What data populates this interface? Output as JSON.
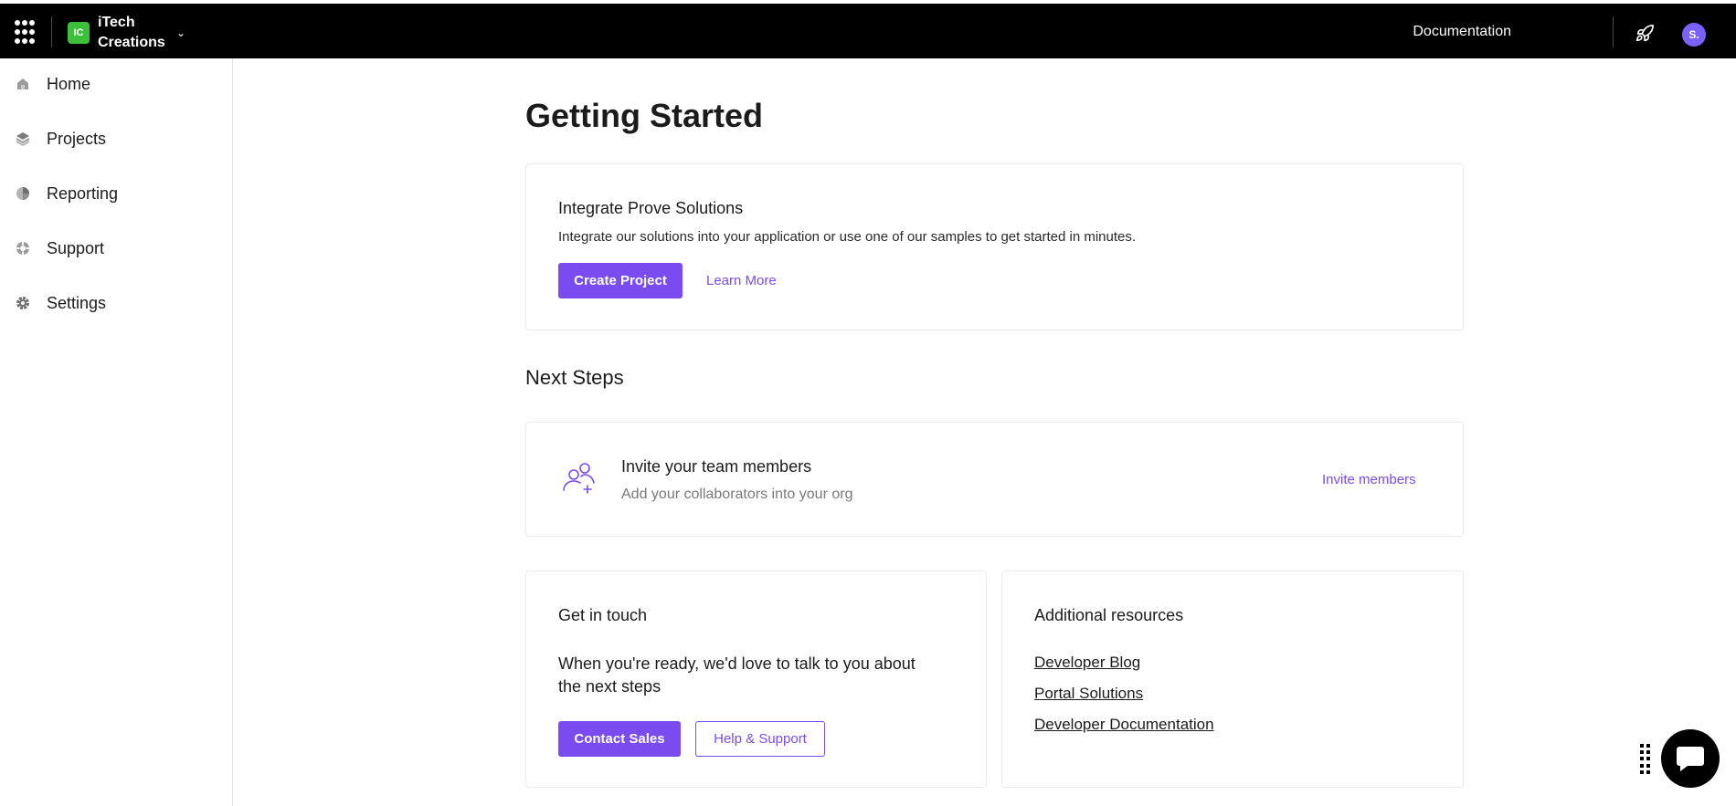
{
  "header": {
    "org_initials": "IC",
    "org_name": "iTech Creations",
    "documentation_label": "Documentation",
    "avatar_initial": "S.",
    "colors": {
      "bar": "#000000",
      "org_badge": "#3ec13a",
      "avatar": "#7b61ff"
    }
  },
  "sidebar": {
    "items": [
      {
        "label": "Home",
        "icon": "home-icon"
      },
      {
        "label": "Projects",
        "icon": "layers-icon"
      },
      {
        "label": "Reporting",
        "icon": "pie-chart-icon"
      },
      {
        "label": "Support",
        "icon": "lifebuoy-icon"
      },
      {
        "label": "Settings",
        "icon": "gear-icon"
      }
    ]
  },
  "main": {
    "title": "Getting Started",
    "integrate": {
      "title": "Integrate Prove Solutions",
      "description": "Integrate our solutions into your application or use one of our samples to get started in minutes.",
      "create_label": "Create Project",
      "learn_label": "Learn More"
    },
    "next_steps_title": "Next Steps",
    "invite": {
      "title": "Invite your team members",
      "subtitle": "Add your collaborators into your org",
      "action_label": "Invite members",
      "icon": "add-user-icon"
    },
    "touch": {
      "title": "Get in touch",
      "text": "When you're ready, we'd love to talk to you about the next steps",
      "contact_label": "Contact Sales",
      "help_label": "Help & Support"
    },
    "resources": {
      "title": "Additional resources",
      "links": [
        "Developer Blog",
        "Portal Solutions",
        "Developer Documentation"
      ]
    }
  },
  "accent": "#7a4cf0"
}
